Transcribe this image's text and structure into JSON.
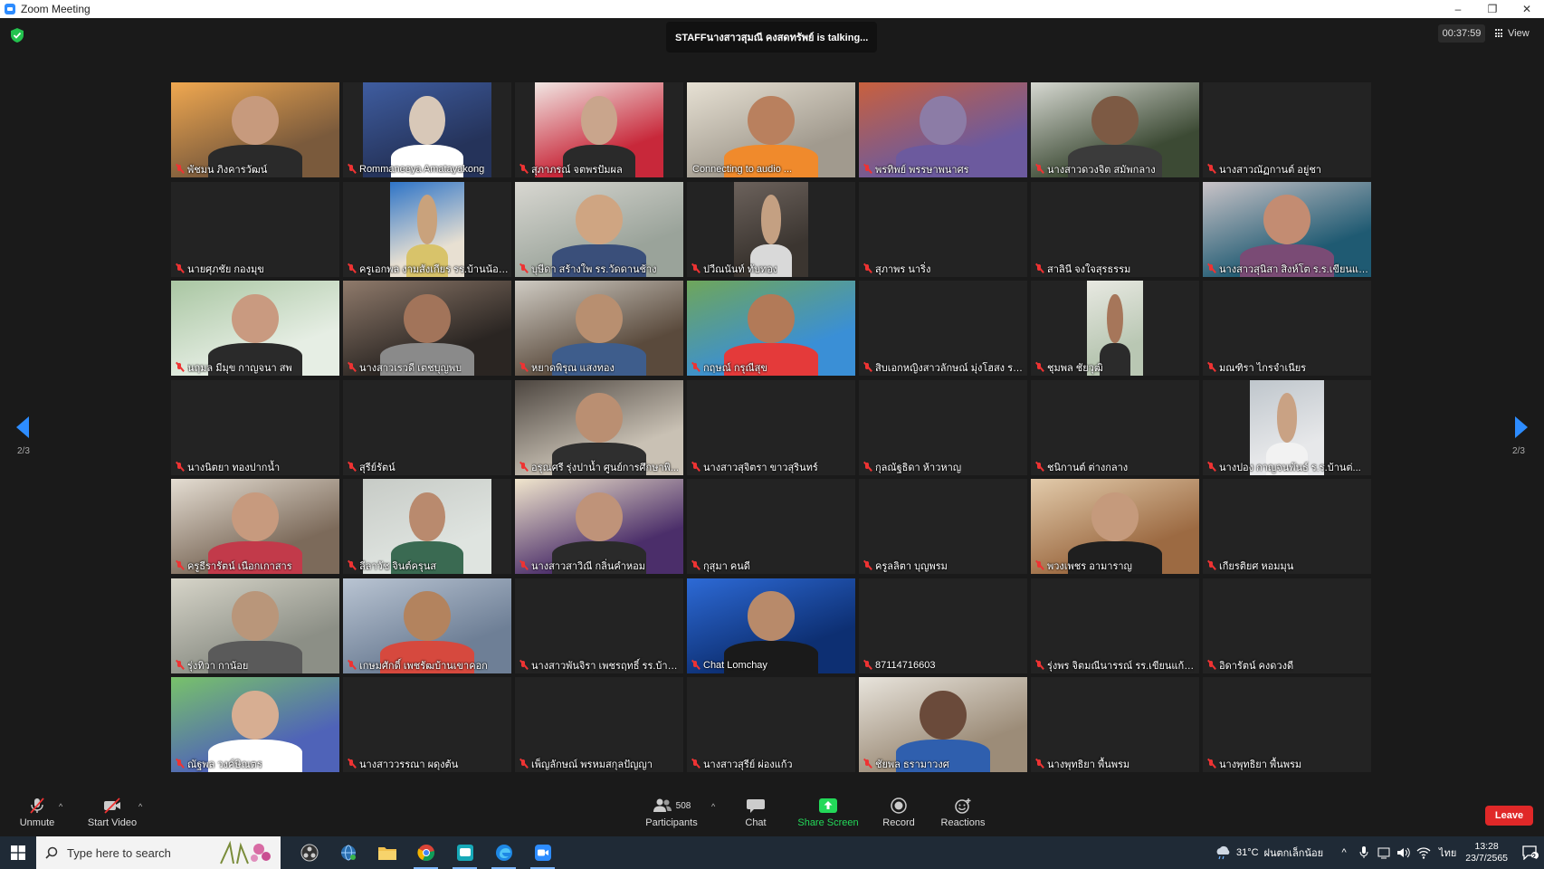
{
  "window": {
    "title": "Zoom Meeting",
    "controls": [
      "–",
      "❐",
      "✕"
    ]
  },
  "meeting": {
    "talking": "STAFFนางสาวสุมณี คงสดทรัพย์ is  talking...",
    "timer": "00:37:59",
    "view_label": "View",
    "page_indicator": "2/3"
  },
  "participants": [
    {
      "name": "พัชมน ภิงคารวัฒน์",
      "video": true,
      "bg": "#7a5a3c",
      "bg2": "#f0a850",
      "skin": "#c79a7d",
      "shirt": "#2a2a2a"
    },
    {
      "name": "Rommaneeya Amatayakong",
      "video": true,
      "bg": "#25335a",
      "bg2": "#3f5da0",
      "skin": "#d8c8b8",
      "shirt": "#ffffff"
    },
    {
      "name": "สุภาภรณ์ จตพรปัมผล",
      "video": true,
      "bg": "#c8283a",
      "bg2": "#f1e6e3",
      "skin": "#c9a58c",
      "shirt": "#2a2a2a"
    },
    {
      "name": "Connecting to audio ...",
      "video": true,
      "muted": false,
      "bg": "#a19a8e",
      "bg2": "#e7e1d4",
      "skin": "#b9805e",
      "shirt": "#f08a2c"
    },
    {
      "name": "พรทิพย์ พรรษาพนาศร",
      "video": true,
      "bg": "#6c5a9e",
      "bg2": "#c9603d",
      "skin": "#8c7ca6",
      "shirt": "#6c5a9e"
    },
    {
      "name": "นางสาวดวงจิต สมัพกลาง",
      "video": true,
      "bg": "#3c4a34",
      "bg2": "#d6d8d1",
      "skin": "#7d5a44",
      "shirt": "#3b3b3b"
    },
    {
      "name": "นางสาวณัฏกานต์ อยู่ชา",
      "video": false
    },
    {
      "name": "นายศุภชัย กองมุข",
      "video": false
    },
    {
      "name": "ครูเอกพล งามสังเกียร รร.บ้านน้อยนาว",
      "video": true,
      "bg": "#e8e0d2",
      "bg2": "#2e74c7",
      "skin": "#c9a27c",
      "shirt": "#d8c36a"
    },
    {
      "name": "บุษีดา สร้างใพ รร.วัดดานช้าง",
      "video": true,
      "bg": "#9aa39a",
      "bg2": "#d8d7d1",
      "skin": "#cfa582",
      "shirt": "#3a4f7a"
    },
    {
      "name": "ปวีณนันท์ ทับทอง",
      "video": true,
      "bg": "#3b3530",
      "bg2": "#6c625c",
      "skin": "#c4a082",
      "shirt": "#d9d9d9"
    },
    {
      "name": "สุภาพร นาริ่ง",
      "video": false
    },
    {
      "name": "สาลินี จงใจสุรธรรม",
      "video": false
    },
    {
      "name": "นางสาวสุนิสา สิงห์โต ร.ร.เขียนแก้ว...",
      "video": true,
      "bg": "#1f5a72",
      "bg2": "#c9c3c7",
      "skin": "#c38c72",
      "shirt": "#7a4b75"
    },
    {
      "name": "นฤมล มีมุข กาญจนา สพ",
      "video": true,
      "bg": "#e6eee4",
      "bg2": "#a9c6a2",
      "skin": "#c99a80",
      "shirt": "#2a2a2a"
    },
    {
      "name": "นางสาวเรวดี เตชบุญพบ",
      "video": true,
      "bg": "#2a2522",
      "bg2": "#8f7a6b",
      "skin": "#a2745a",
      "shirt": "#8a8a8a"
    },
    {
      "name": "หยาดพิรุณ แสงทอง",
      "video": true,
      "bg": "#5a4a3c",
      "bg2": "#cfcbc3",
      "skin": "#b88f70",
      "shirt": "#3e5d8c"
    },
    {
      "name": "กฤษณ์ กรุณีสุข",
      "video": true,
      "bg": "#3a8fd6",
      "bg2": "#6fa65a",
      "skin": "#b27a58",
      "shirt": "#e43a3a"
    },
    {
      "name": "สิบเอกหญิงสาวลักษณ์ มุ่งโฮสง รร.ว...",
      "video": false
    },
    {
      "name": "ชุมพล ชัยวุฒิ",
      "video": true,
      "bg": "#b9c7b3",
      "bg2": "#e8e9e2",
      "skin": "#a6765a",
      "shirt": "#2b2b2b"
    },
    {
      "name": "มณฑิรา ไกรจำเนียร",
      "video": false
    },
    {
      "name": "นางนิตยา ทองปากน้ำ",
      "video": false
    },
    {
      "name": "สุรีย์รัตน์",
      "video": false
    },
    {
      "name": "อรุณศรี รุ่งปาน้ำ ศูนย์การศึกษาพิ...",
      "video": true,
      "bg": "#c9c1b4",
      "bg2": "#4d4640",
      "skin": "#ba8f72",
      "shirt": "#2f2f2f"
    },
    {
      "name": "นางสาวสุจิตรา ขาวสุรินทร์",
      "video": false
    },
    {
      "name": "กุลณัฐธิดา ห้าวหาญ",
      "video": false
    },
    {
      "name": "ชนิกานต์ ต่างกลาง",
      "video": false
    },
    {
      "name": "นางปอง กาญจนพันธ์ ร.ร.บ้านต่...",
      "video": true,
      "bg": "#e7e8ea",
      "bg2": "#bfc6cc",
      "skin": "#c9a284",
      "shirt": "#f2f2f2"
    },
    {
      "name": "ครูธีรารัตน์ เนือกเกาสาร",
      "video": true,
      "bg": "#7c6a5a",
      "bg2": "#e4ddd2",
      "skin": "#c79a7e",
      "shirt": "#c23a4a"
    },
    {
      "name": "ลีลาวัช จินต์ครุนส",
      "video": true,
      "bg": "#dfe4e0",
      "bg2": "#c7cbc6",
      "skin": "#b98a6e",
      "shirt": "#3a6a52"
    },
    {
      "name": "นางสาวสาวิณี กลิ่นคำหอม",
      "video": true,
      "bg": "#4b2e6a",
      "bg2": "#f1e6cd",
      "skin": "#bf9379",
      "shirt": "#2a2a2a"
    },
    {
      "name": "กุสุมา คนดี",
      "video": false
    },
    {
      "name": "ครูลลิตา บุญพรม",
      "video": false
    },
    {
      "name": "พวงเพชร อามาราญ",
      "video": true,
      "bg": "#9c6a42",
      "bg2": "#e2cbab",
      "skin": "#c59a7c",
      "shirt": "#1f1f1f"
    },
    {
      "name": "เกียรติยศ หอมมุน",
      "video": false
    },
    {
      "name": "รุ่งทิวา กาน้อย",
      "video": true,
      "bg": "#8c8f86",
      "bg2": "#d6d4c8",
      "skin": "#b9967a",
      "shirt": "#5a5a5a"
    },
    {
      "name": "เกษมศักดิ์ เพชรัฒบ้านเขาคอก",
      "video": true,
      "bg": "#6e7f96",
      "bg2": "#b9c4d2",
      "skin": "#b3835e",
      "shirt": "#d6493e"
    },
    {
      "name": "นางสาวพันจิรา เพชรฤทธิ์ รร.บ้าน...",
      "video": false
    },
    {
      "name": "Chat Lomchay",
      "video": true,
      "bg": "#0d2f72",
      "bg2": "#2d6ad6",
      "skin": "#b88a6a",
      "shirt": "#1a1a1a"
    },
    {
      "name": "87114716603",
      "video": false
    },
    {
      "name": "รุ่งพร จิตมณีนารรณ์ รร.เขียนแก้ววิท...",
      "video": false
    },
    {
      "name": "อิดารัตน์ คงดวงดี",
      "video": false
    },
    {
      "name": "ณัฐพล วงค์ษิณตร",
      "video": true,
      "bg": "#4f63b8",
      "bg2": "#78c26a",
      "skin": "#d7ae92",
      "shirt": "#ffffff"
    },
    {
      "name": "นางสาววรรณา ผดุงต้น",
      "video": false
    },
    {
      "name": "เพ็ญลักษณ์ พรหมสกุลปัญญา",
      "video": false
    },
    {
      "name": "นางสาวสุรีย์ ผ่องแก้ว",
      "video": false
    },
    {
      "name": "ชัยพล ธรามาวงศ",
      "video": true,
      "bg": "#9c8c78",
      "bg2": "#e8e4dc",
      "skin": "#6a4a3a",
      "shirt": "#2f5fae"
    },
    {
      "name": "นางพุทธิยา พื้นพรม",
      "video": false
    },
    {
      "name": "นางพุทธิยา พื้นพรม",
      "video": false
    }
  ],
  "toolbar": {
    "unmute": "Unmute",
    "start_video": "Start Video",
    "participants_count": "508",
    "participants": "Participants",
    "chat": "Chat",
    "share_screen": "Share Screen",
    "record": "Record",
    "reactions": "Reactions",
    "leave": "Leave"
  },
  "taskbar": {
    "search_placeholder": "Type here to search",
    "temperature": "31°C",
    "weather": "ฝนตกเล็กน้อย",
    "lang": "ไทย",
    "time": "13:28",
    "date": "23/7/2565",
    "notif_count": "2"
  },
  "colors": {
    "accent": "#2d8cff",
    "leave": "#e02828",
    "share": "#23d959",
    "mute": "#e33333"
  }
}
